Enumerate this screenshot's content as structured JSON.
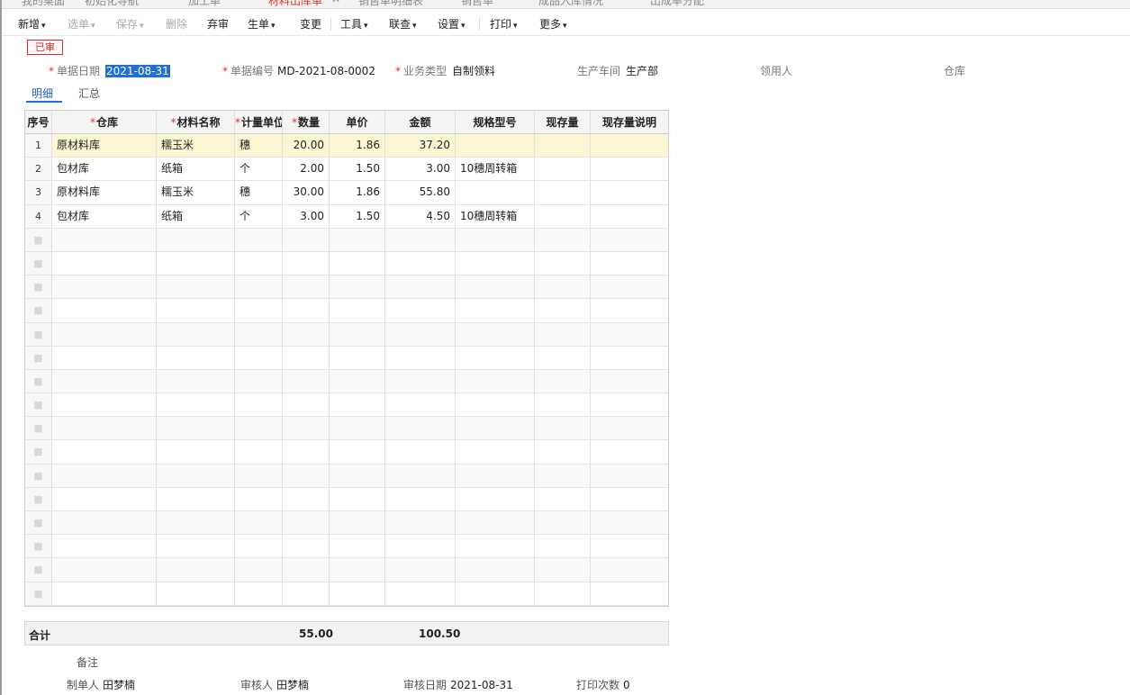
{
  "tabs": [
    {
      "label": "我的桌面",
      "active": false
    },
    {
      "label": "初始化导航",
      "active": false
    },
    {
      "label": "加工单",
      "active": false
    },
    {
      "label": "材料出库单",
      "active": true
    },
    {
      "label": "销售单明细表",
      "active": false
    },
    {
      "label": "销售单",
      "active": false
    },
    {
      "label": "成品入库情况",
      "active": false
    },
    {
      "label": "出成率分配",
      "active": false
    }
  ],
  "toolbar": {
    "new": "新增",
    "pick": "选单",
    "save": "保存",
    "delete": "删除",
    "unaudit": "弃审",
    "generate": "生单",
    "change": "变更",
    "tools": "工具",
    "query": "联查",
    "settings": "设置",
    "print": "打印",
    "more": "更多"
  },
  "status": "已审",
  "header": {
    "date_label": "单据日期",
    "date_value": "2021-08-31",
    "code_label": "单据编号",
    "code_value": "MD-2021-08-0002",
    "biz_label": "业务类型",
    "biz_value": "自制领料",
    "workshop_label": "生产车间",
    "workshop_value": "生产部",
    "receiver_label": "领用人",
    "receiver_value": "",
    "warehouse_label": "仓库",
    "warehouse_value": ""
  },
  "subtabs": {
    "detail": "明细",
    "summary": "汇总"
  },
  "table": {
    "columns": {
      "idx": "序号",
      "warehouse": "仓库",
      "material": "材料名称",
      "unit": "计量单位",
      "qty": "数量",
      "price": "单价",
      "amount": "金额",
      "spec": "规格型号",
      "stock": "现存量",
      "stock_desc": "现存量说明"
    },
    "rows": [
      {
        "idx": "1",
        "warehouse": "原材料库",
        "material": "糯玉米",
        "unit": "穗",
        "qty": "20.00",
        "price": "1.86",
        "amount": "37.20",
        "spec": "",
        "stock": "",
        "stock_desc": ""
      },
      {
        "idx": "2",
        "warehouse": "包材库",
        "material": "纸箱",
        "unit": "个",
        "qty": "2.00",
        "price": "1.50",
        "amount": "3.00",
        "spec": "10穗周转箱",
        "stock": "",
        "stock_desc": ""
      },
      {
        "idx": "3",
        "warehouse": "原材料库",
        "material": "糯玉米",
        "unit": "穗",
        "qty": "30.00",
        "price": "1.86",
        "amount": "55.80",
        "spec": "",
        "stock": "",
        "stock_desc": ""
      },
      {
        "idx": "4",
        "warehouse": "包材库",
        "material": "纸箱",
        "unit": "个",
        "qty": "3.00",
        "price": "1.50",
        "amount": "4.50",
        "spec": "10穗周转箱",
        "stock": "",
        "stock_desc": ""
      }
    ]
  },
  "totals": {
    "label": "合计",
    "qty": "55.00",
    "amount": "100.50"
  },
  "footer": {
    "remark_label": "备注",
    "maker_label": "制单人",
    "maker_value": "田梦楠",
    "auditor_label": "审核人",
    "auditor_value": "田梦楠",
    "audit_date_label": "审核日期",
    "audit_date_value": "2021-08-31",
    "print_count_label": "打印次数",
    "print_count_value": "0"
  }
}
